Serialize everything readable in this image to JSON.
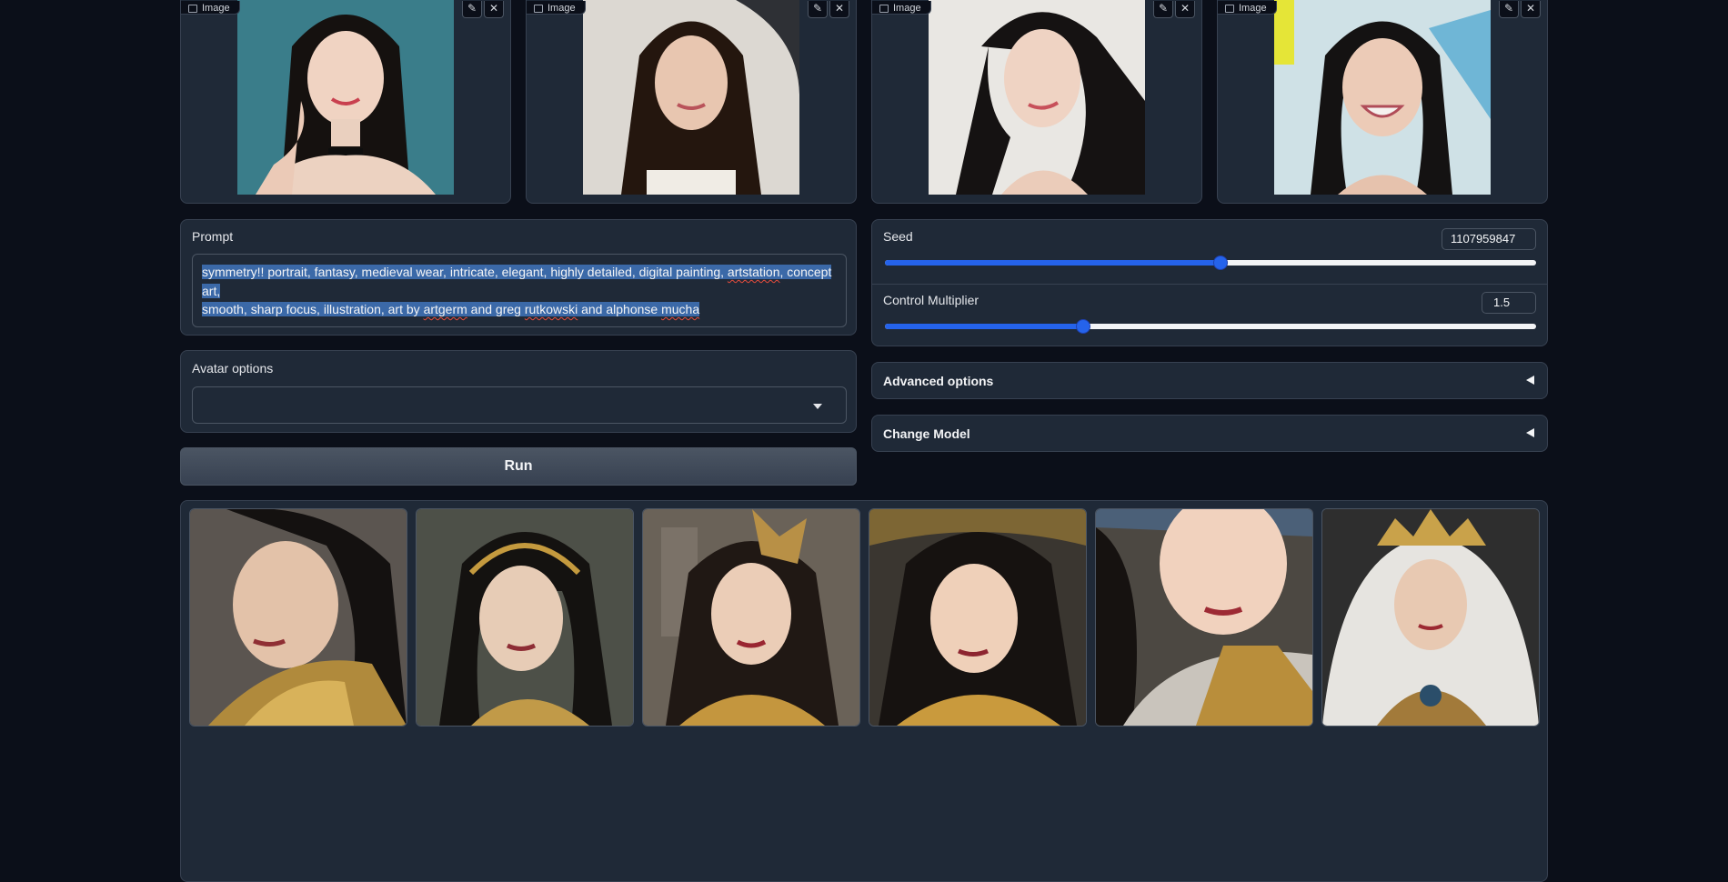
{
  "inputs": [
    {
      "label": "Image",
      "bg": "#3a7d8a"
    },
    {
      "label": "Image",
      "bg": "#d9d4cc"
    },
    {
      "label": "Image",
      "bg": "#e8e6e2"
    },
    {
      "label": "Image",
      "bg": "#c7d7dc"
    }
  ],
  "prompt": {
    "label": "Prompt",
    "line1": [
      {
        "t": "symmetry!! portrait, fantasy, medieval wear, intricate, elegant, highly detailed, digital painting, ",
        "sq": false
      },
      {
        "t": "artstation",
        "sq": true
      },
      {
        "t": ", concept art,",
        "sq": false
      }
    ],
    "line2": [
      {
        "t": "smooth, sharp focus, illustration, art by ",
        "sq": false
      },
      {
        "t": "artgerm",
        "sq": true
      },
      {
        "t": " and greg ",
        "sq": false
      },
      {
        "t": "rutkowski",
        "sq": true
      },
      {
        "t": " and alphonse ",
        "sq": false
      },
      {
        "t": "mucha",
        "sq": true
      }
    ]
  },
  "avatar": {
    "label": "Avatar options",
    "value": ""
  },
  "run_label": "Run",
  "seed": {
    "label": "Seed",
    "value": "1107959847",
    "fraction": 0.516
  },
  "control": {
    "label": "Control Multiplier",
    "value": "1.5",
    "fraction": 0.305
  },
  "advanced_label": "Advanced options",
  "change_model_label": "Change Model",
  "gallery": [
    {
      "name": "gallery-image-1",
      "bg": "#5b5550"
    },
    {
      "name": "gallery-image-2",
      "bg": "#4d5048"
    },
    {
      "name": "gallery-image-3",
      "bg": "#6a6258"
    },
    {
      "name": "gallery-image-4",
      "bg": "#3a3630"
    },
    {
      "name": "gallery-image-5",
      "bg": "#4c4842"
    },
    {
      "name": "gallery-image-6",
      "bg": "#2e2e2e"
    }
  ],
  "colors": {
    "background": "#0b0f19",
    "panel": "#1f2937",
    "border": "#374151",
    "accent": "#2563eb",
    "selection": "#3b69a8"
  }
}
